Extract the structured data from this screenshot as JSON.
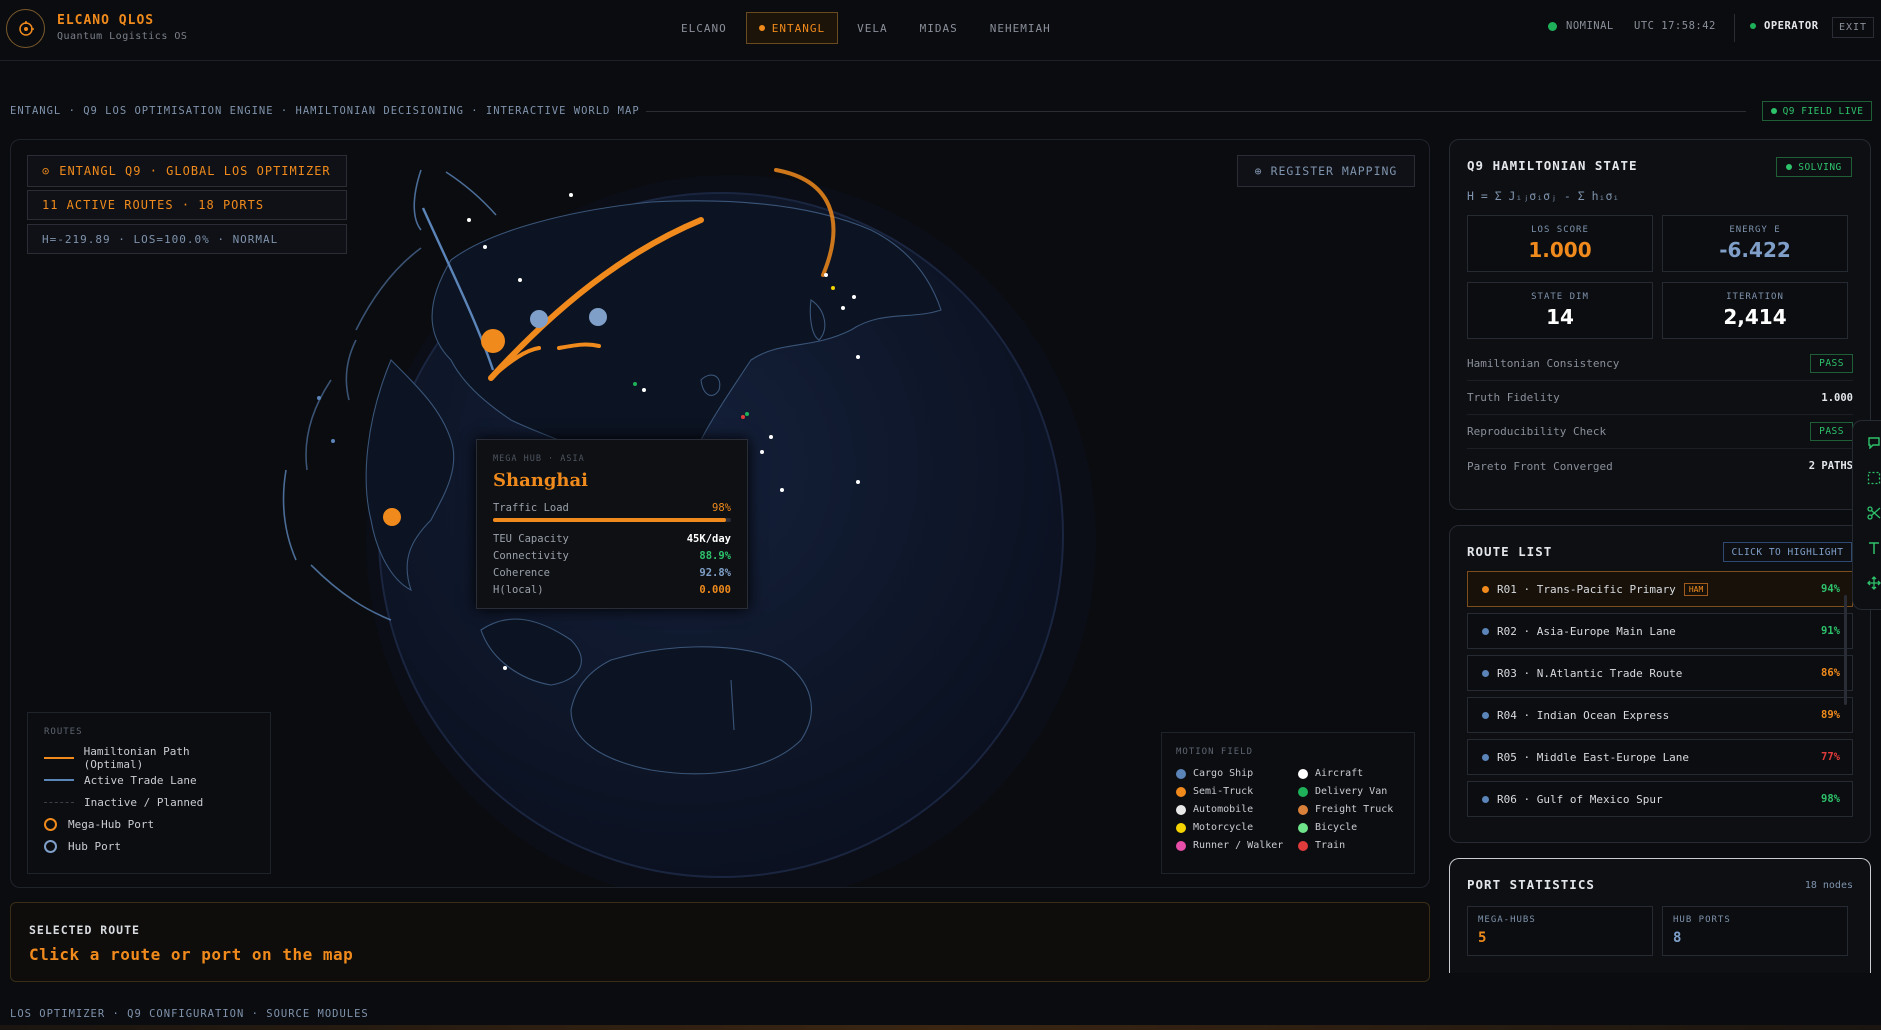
{
  "app": {
    "name": "ELCANO QLOS",
    "subtitle": "Quantum Logistics OS"
  },
  "nav": [
    {
      "label": "ELCANO",
      "active": false
    },
    {
      "label": "ENTANGL",
      "active": true
    },
    {
      "label": "VELA",
      "active": false
    },
    {
      "label": "MIDAS",
      "active": false
    },
    {
      "label": "NEHEMIAH",
      "active": false
    }
  ],
  "status": {
    "state": "NOMINAL",
    "clock": "UTC 17:58:42",
    "user": "OPERATOR",
    "exit": "EXIT"
  },
  "breadcrumb": "ENTANGL · Q9 LOS OPTIMISATION ENGINE · HAMILTONIAN DECISIONING · INTERACTIVE WORLD MAP",
  "field_badge": "Q9 FIELD LIVE",
  "map": {
    "title": "ENTANGL Q9 · GLOBAL LOS OPTIMIZER",
    "routes_info": "11 ACTIVE ROUTES · 18 PORTS",
    "metrics_info": "H=-219.89 · LOS=100.0% · NORMAL",
    "register_button": "REGISTER MAPPING",
    "register_icon": "target-icon",
    "tooltip": {
      "kicker": "MEGA HUB · ASIA",
      "name": "Shanghai",
      "traffic_label": "Traffic Load",
      "traffic_value": "98%",
      "traffic_level": 0.98,
      "rows": [
        {
          "label": "TEU Capacity",
          "value": "45K/day",
          "color": "#ffffff"
        },
        {
          "label": "Connectivity",
          "value": "88.9%",
          "color": "#2ec26b"
        },
        {
          "label": "Coherence",
          "value": "92.8%",
          "color": "#7f9fc8"
        },
        {
          "label": "H(local)",
          "value": "0.000",
          "color": "#f08a1c"
        }
      ]
    },
    "legend": {
      "title": "ROUTES",
      "items": [
        {
          "label": "Hamiltonian Path (Optimal)",
          "kind": "line",
          "color": "#f08a1c"
        },
        {
          "label": "Active Trade Lane",
          "kind": "line",
          "color": "#5b84b8"
        },
        {
          "label": "Inactive / Planned",
          "kind": "dash",
          "color": "#3a3f4a"
        },
        {
          "label": "Mega-Hub Port",
          "kind": "ring",
          "color": "#f08a1c"
        },
        {
          "label": "Hub Port",
          "kind": "ring",
          "color": "#7f9fc8"
        }
      ]
    },
    "motion": {
      "title": "MOTION FIELD",
      "items": [
        {
          "label": "Cargo Ship",
          "color": "#5b84b8"
        },
        {
          "label": "Aircraft",
          "color": "#ffffff"
        },
        {
          "label": "Semi-Truck",
          "color": "#f08a1c"
        },
        {
          "label": "Delivery Van",
          "color": "#1fb15a"
        },
        {
          "label": "Automobile",
          "color": "#e8e8e8"
        },
        {
          "label": "Freight Truck",
          "color": "#d9803a"
        },
        {
          "label": "Motorcycle",
          "color": "#f5d300"
        },
        {
          "label": "Bicycle",
          "color": "#6fe38a"
        },
        {
          "label": "Runner / Walker",
          "color": "#e64ea8"
        },
        {
          "label": "Train",
          "color": "#e23b3b"
        }
      ]
    }
  },
  "selected_route": {
    "label": "SELECTED ROUTE",
    "value": "Click a route or port on the map"
  },
  "footer": "LOS OPTIMIZER · Q9 CONFIGURATION · SOURCE MODULES",
  "hamiltonian": {
    "title": "Q9 HAMILTONIAN STATE",
    "badge": "SOLVING",
    "formula": "H = Σ Jᵢⱼσᵢσⱼ - Σ hᵢσᵢ",
    "metrics": [
      {
        "label": "LOS SCORE",
        "value": "1.000",
        "color": "#f08a1c"
      },
      {
        "label": "ENERGY E",
        "value": "-6.422",
        "color": "#7f9fc8"
      },
      {
        "label": "STATE DIM",
        "value": "14",
        "color": "#ffffff"
      },
      {
        "label": "ITERATION",
        "value": "2,414",
        "color": "#ffffff"
      }
    ],
    "checks": [
      {
        "label": "Hamiltonian Consistency",
        "value": "PASS",
        "badge": true
      },
      {
        "label": "Truth Fidelity",
        "value": "1.000",
        "badge": false
      },
      {
        "label": "Reproducibility Check",
        "value": "PASS",
        "badge": true
      },
      {
        "label": "Pareto Front Converged",
        "value": "2 PATHS",
        "badge": false
      }
    ]
  },
  "route_list": {
    "title": "ROUTE LIST",
    "action": "CLICK TO HIGHLIGHT",
    "routes": [
      {
        "label": "R01 · Trans-Pacific Primary",
        "tag": "HAM",
        "pct": "94%",
        "color": "#f08a1c",
        "pct_color": "#2ec26b"
      },
      {
        "label": "R02 · Asia-Europe Main Lane",
        "tag": "",
        "pct": "91%",
        "color": "#5b84b8",
        "pct_color": "#2ec26b"
      },
      {
        "label": "R03 · N.Atlantic Trade Route",
        "tag": "",
        "pct": "86%",
        "color": "#5b84b8",
        "pct_color": "#f08a1c"
      },
      {
        "label": "R04 · Indian Ocean Express",
        "tag": "",
        "pct": "89%",
        "color": "#5b84b8",
        "pct_color": "#f08a1c"
      },
      {
        "label": "R05 · Middle East-Europe Lane",
        "tag": "",
        "pct": "77%",
        "color": "#5b84b8",
        "pct_color": "#e23b3b"
      },
      {
        "label": "R06 · Gulf of Mexico Spur",
        "tag": "",
        "pct": "98%",
        "color": "#5b84b8",
        "pct_color": "#2ec26b"
      }
    ]
  },
  "port_stats": {
    "title": "PORT STATISTICS",
    "count": "18 nodes",
    "cells": [
      {
        "label": "MEGA-HUBS",
        "value": "5",
        "color": "#f08a1c"
      },
      {
        "label": "HUB PORTS",
        "value": "8",
        "color": "#7f9fc8"
      }
    ]
  },
  "edge_tools": [
    "chat-bubble-icon",
    "select-area-icon",
    "scissors-icon",
    "text-icon",
    "move-icon"
  ]
}
